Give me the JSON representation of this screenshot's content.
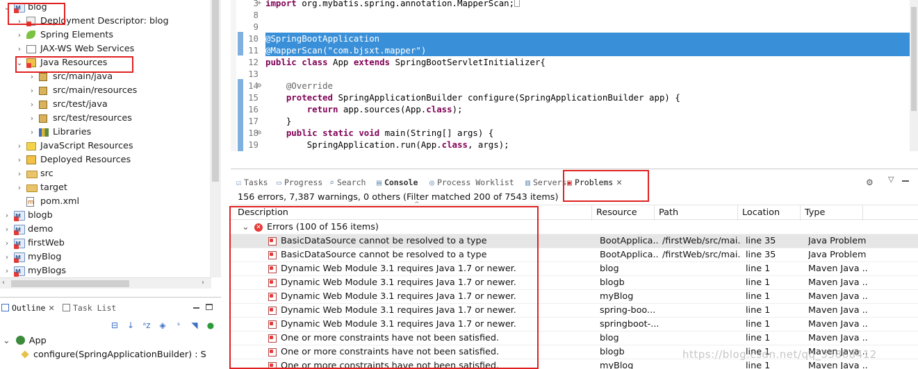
{
  "explorer": {
    "items": [
      {
        "label": "blog",
        "level": 0,
        "icon": "maven-project-icon",
        "twisty": "expanded"
      },
      {
        "label": "Deployment Descriptor: blog",
        "level": 1,
        "icon": "deployment-descriptor-icon",
        "twisty": "collapsed"
      },
      {
        "label": "Spring Elements",
        "level": 1,
        "icon": "spring-leaf-icon",
        "twisty": "collapsed"
      },
      {
        "label": "JAX-WS Web Services",
        "level": 1,
        "icon": "web-services-icon",
        "twisty": "collapsed"
      },
      {
        "label": "Java Resources",
        "level": 1,
        "icon": "java-resources-icon",
        "twisty": "expanded"
      },
      {
        "label": "src/main/java",
        "level": 2,
        "icon": "source-folder-icon",
        "twisty": "collapsed"
      },
      {
        "label": "src/main/resources",
        "level": 2,
        "icon": "source-folder-icon",
        "twisty": "collapsed"
      },
      {
        "label": "src/test/java",
        "level": 2,
        "icon": "source-folder-icon",
        "twisty": "collapsed"
      },
      {
        "label": "src/test/resources",
        "level": 2,
        "icon": "source-folder-icon",
        "twisty": "collapsed"
      },
      {
        "label": "Libraries",
        "level": 2,
        "icon": "libraries-icon",
        "twisty": "collapsed"
      },
      {
        "label": "JavaScript Resources",
        "level": 1,
        "icon": "javascript-resources-icon",
        "twisty": "collapsed"
      },
      {
        "label": "Deployed Resources",
        "level": 1,
        "icon": "deployed-resources-icon",
        "twisty": "collapsed"
      },
      {
        "label": "src",
        "level": 1,
        "icon": "folder-icon",
        "twisty": "collapsed"
      },
      {
        "label": "target",
        "level": 1,
        "icon": "folder-icon",
        "twisty": "collapsed"
      },
      {
        "label": "pom.xml",
        "level": 1,
        "icon": "pom-file-icon",
        "twisty": "none"
      },
      {
        "label": "blogb",
        "level": 0,
        "icon": "maven-project-icon",
        "twisty": "collapsed"
      },
      {
        "label": "demo",
        "level": 0,
        "icon": "maven-project-icon",
        "twisty": "collapsed"
      },
      {
        "label": "firstWeb",
        "level": 0,
        "icon": "maven-project-icon",
        "twisty": "collapsed"
      },
      {
        "label": "myBlog",
        "level": 0,
        "icon": "maven-project-icon",
        "twisty": "collapsed"
      },
      {
        "label": "myBlogs",
        "level": 0,
        "icon": "maven-project-icon",
        "twisty": "collapsed"
      }
    ]
  },
  "outline": {
    "tabs": [
      {
        "label": "Outline",
        "active": true
      },
      {
        "label": "Task List",
        "active": false
      }
    ],
    "toolbar_icons": [
      "collapse-all-icon",
      "sort-icon",
      "sort-alpha-icon",
      "hide-fields-icon",
      "hide-static-icon",
      "hide-nonpublic-icon",
      "green-dot-icon",
      "filter-icon"
    ],
    "items": [
      {
        "label": "App",
        "level": 0
      },
      {
        "label": "configure(SpringApplicationBuilder) : S",
        "level": 1
      }
    ]
  },
  "editor": {
    "lines": [
      {
        "num": "3",
        "fold": "+",
        "html": "<span class=\"kw\">import</span> org.mybatis.spring.annotation.MapperScan;<span style=\"border:1px solid #999;display:inline-block;width:8px;height:11px;vertical-align:-1px\"></span>",
        "selected": false
      },
      {
        "num": "8",
        "fold": "",
        "html": "",
        "selected": false
      },
      {
        "num": "9",
        "fold": "",
        "html": "",
        "selected": false
      },
      {
        "num": "10",
        "fold": "",
        "html": "<span class=\"an\">@SpringBootApplication</span>",
        "selected": true
      },
      {
        "num": "11",
        "fold": "",
        "html": "<span class=\"an\">@MapperScan</span>(<span class=\"str\">\"com.bjsxt.mapper\"</span>)",
        "selected": true
      },
      {
        "num": "12",
        "fold": "",
        "html": "<span class=\"kw\">public</span> <span class=\"kw\">class</span> App <span class=\"kw\">extends</span> SpringBootServletInitializer{",
        "selected": false
      },
      {
        "num": "13",
        "fold": "",
        "html": "",
        "selected": false
      },
      {
        "num": "14",
        "fold": "⊖",
        "html": "    <span class=\"an\">@Override</span>",
        "selected": false
      },
      {
        "num": "15",
        "fold": "",
        "html": "    <span class=\"kw\">protected</span> SpringApplicationBuilder configure(SpringApplicationBuilder app) {",
        "selected": false
      },
      {
        "num": "16",
        "fold": "",
        "html": "        <span class=\"kw\">return</span> app.sources(App.<span class=\"kw\">class</span>);",
        "selected": false
      },
      {
        "num": "17",
        "fold": "",
        "html": "    }",
        "selected": false
      },
      {
        "num": "18",
        "fold": "⊖",
        "html": "    <span class=\"kw\">public</span> <span class=\"kw\">static</span> <span class=\"kw\">void</span> main(String[] args) {",
        "selected": false
      },
      {
        "num": "19",
        "fold": "",
        "html": "        SpringApplication.run(App.<span class=\"kw\">class</span>, args);",
        "selected": false
      }
    ]
  },
  "panel": {
    "tabs": [
      {
        "label": "Tasks",
        "icon": "tasks-icon",
        "active": false
      },
      {
        "label": "Progress",
        "icon": "progress-icon",
        "active": false
      },
      {
        "label": "Search",
        "icon": "search-icon",
        "active": false
      },
      {
        "label": "Console",
        "icon": "console-icon",
        "active": false,
        "bold": true
      },
      {
        "label": "Process Worklist",
        "icon": "process-worklist-icon",
        "active": false
      },
      {
        "label": "Servers",
        "icon": "servers-icon",
        "active": false
      },
      {
        "label": "Problems",
        "icon": "problems-icon",
        "active": true
      }
    ],
    "summary": "156 errors, 7,387 warnings, 0 others (Filter matched 200 of 7543 items)",
    "columns": [
      "Description",
      "Resource",
      "Path",
      "Location",
      "Type"
    ],
    "group": "Errors (100 of 156 items)",
    "rows": [
      {
        "description": "BasicDataSource cannot be resolved to a type",
        "resource": "BootApplica...",
        "path": "/firstWeb/src/mai...",
        "location": "line 35",
        "type": "Java Problem"
      },
      {
        "description": "BasicDataSource cannot be resolved to a type",
        "resource": "BootApplica...",
        "path": "/firstWeb/src/mai...",
        "location": "line 35",
        "type": "Java Problem"
      },
      {
        "description": "Dynamic Web Module 3.1 requires Java 1.7 or newer.",
        "resource": "blog",
        "path": "",
        "location": "line 1",
        "type": "Maven Java ..."
      },
      {
        "description": "Dynamic Web Module 3.1 requires Java 1.7 or newer.",
        "resource": "blogb",
        "path": "",
        "location": "line 1",
        "type": "Maven Java ..."
      },
      {
        "description": "Dynamic Web Module 3.1 requires Java 1.7 or newer.",
        "resource": "myBlog",
        "path": "",
        "location": "line 1",
        "type": "Maven Java ..."
      },
      {
        "description": "Dynamic Web Module 3.1 requires Java 1.7 or newer.",
        "resource": "spring-boo...",
        "path": "",
        "location": "line 1",
        "type": "Maven Java ..."
      },
      {
        "description": "Dynamic Web Module 3.1 requires Java 1.7 or newer.",
        "resource": "springboot-...",
        "path": "",
        "location": "line 1",
        "type": "Maven Java ..."
      },
      {
        "description": "One or more constraints have not been satisfied.",
        "resource": "blog",
        "path": "",
        "location": "line 1",
        "type": "Maven Java ..."
      },
      {
        "description": "One or more constraints have not been satisfied.",
        "resource": "blogb",
        "path": "",
        "location": "line 1",
        "type": "Maven Java ..."
      },
      {
        "description": "One or more constraints have not been satisfied.",
        "resource": "myBlog",
        "path": "",
        "location": "line 1",
        "type": "Maven Java ..."
      }
    ]
  },
  "watermark": "https://blog.csdn.net/qq_35868412",
  "colors": {
    "highlight_box": "#e02020",
    "selection": "#3a90d8",
    "error": "#e53935"
  }
}
